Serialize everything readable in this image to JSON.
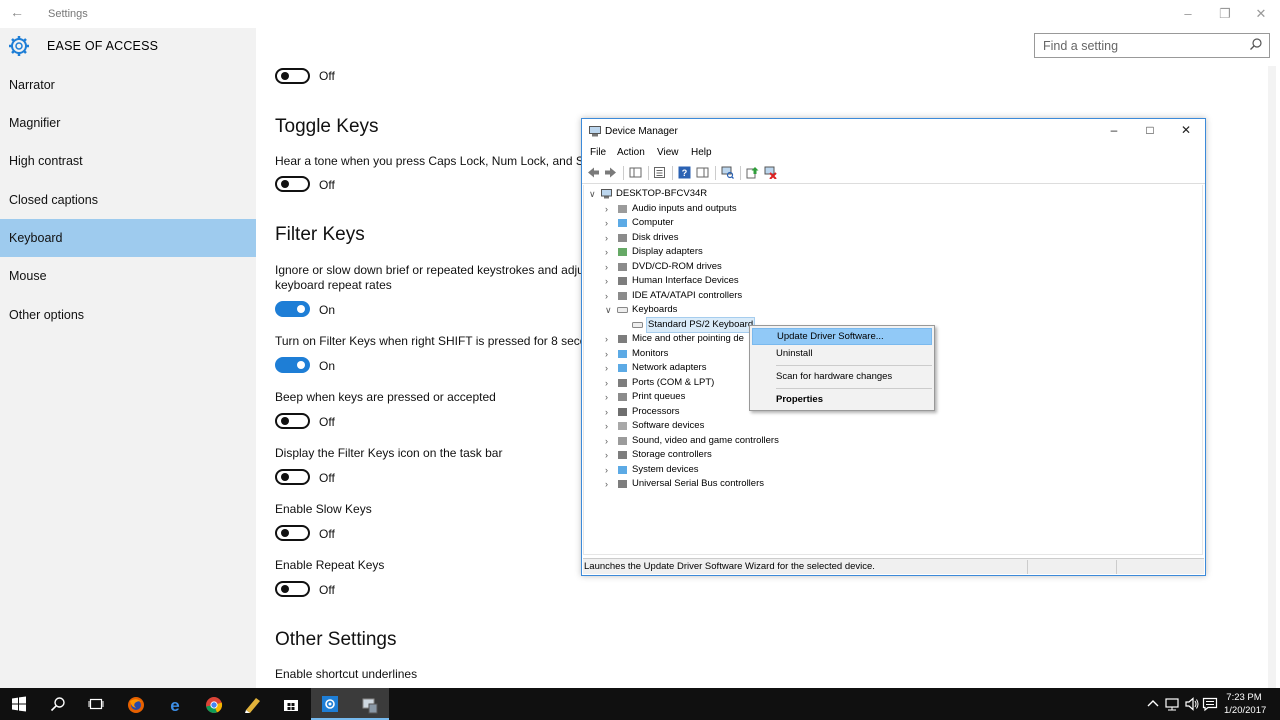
{
  "settings": {
    "app_title": "Settings",
    "header": "EASE OF ACCESS",
    "search_placeholder": "Find a setting",
    "nav": [
      {
        "label": "Narrator"
      },
      {
        "label": "Magnifier"
      },
      {
        "label": "High contrast"
      },
      {
        "label": "Closed captions"
      },
      {
        "label": "Keyboard",
        "active": true
      },
      {
        "label": "Mouse"
      },
      {
        "label": "Other options"
      }
    ],
    "content": {
      "top_toggle_state": "Off",
      "toggle_keys": {
        "heading": "Toggle Keys",
        "desc": "Hear a tone when you press Caps Lock, Num Lock, and Sc",
        "state": "Off"
      },
      "filter_keys": {
        "heading": "Filter Keys",
        "desc1": "Ignore or slow down brief or repeated keystrokes and adju",
        "desc2": "keyboard repeat rates",
        "state": "On",
        "options": [
          {
            "label": "Turn on Filter Keys when right SHIFT is pressed for 8 secon",
            "state": "On"
          },
          {
            "label": "Beep when keys are pressed or accepted",
            "state": "Off"
          },
          {
            "label": "Display the Filter Keys icon on the task bar",
            "state": "Off"
          },
          {
            "label": "Enable Slow Keys",
            "state": "Off"
          },
          {
            "label": "Enable Repeat Keys",
            "state": "Off"
          }
        ]
      },
      "other_settings": {
        "heading": "Other Settings",
        "desc": "Enable shortcut underlines"
      }
    }
  },
  "device_manager": {
    "title": "Device Manager",
    "menu": [
      "File",
      "Action",
      "View",
      "Help"
    ],
    "root": "DESKTOP-BFCV34R",
    "tree": [
      {
        "label": "Audio inputs and outputs",
        "icon": "speaker-icon"
      },
      {
        "label": "Computer",
        "icon": "computer-icon"
      },
      {
        "label": "Disk drives",
        "icon": "disk-icon"
      },
      {
        "label": "Display adapters",
        "icon": "display-adapter-icon"
      },
      {
        "label": "DVD/CD-ROM drives",
        "icon": "dvd-icon"
      },
      {
        "label": "Human Interface Devices",
        "icon": "hid-icon"
      },
      {
        "label": "IDE ATA/ATAPI controllers",
        "icon": "ide-icon"
      },
      {
        "label": "Keyboards",
        "icon": "keyboard-icon",
        "expanded": true
      },
      {
        "label": "Standard PS/2 Keyboard",
        "icon": "keyboard-icon",
        "child": true,
        "selected": true
      },
      {
        "label": "Mice and other pointing de",
        "icon": "mouse-icon"
      },
      {
        "label": "Monitors",
        "icon": "monitor-icon"
      },
      {
        "label": "Network adapters",
        "icon": "network-icon"
      },
      {
        "label": "Ports (COM & LPT)",
        "icon": "port-icon"
      },
      {
        "label": "Print queues",
        "icon": "printer-icon"
      },
      {
        "label": "Processors",
        "icon": "processor-icon"
      },
      {
        "label": "Software devices",
        "icon": "software-device-icon"
      },
      {
        "label": "Sound, video and game controllers",
        "icon": "sound-icon"
      },
      {
        "label": "Storage controllers",
        "icon": "storage-icon"
      },
      {
        "label": "System devices",
        "icon": "system-icon"
      },
      {
        "label": "Universal Serial Bus controllers",
        "icon": "usb-icon"
      }
    ],
    "context_menu": [
      {
        "label": "Update Driver Software...",
        "highlighted": true
      },
      {
        "label": "Uninstall"
      },
      {
        "label": "Scan for hardware changes"
      },
      {
        "label": "Properties",
        "bold": true
      }
    ],
    "status": "Launches the Update Driver Software Wizard for the selected device."
  },
  "taskbar": {
    "time": "7:23 PM",
    "date": "1/20/2017"
  },
  "colors": {
    "selection_blue": "#9ecbee",
    "toggle_on": "#1e7ed6",
    "taskbar": "#101010",
    "menu_highlight": "#91c9f7"
  }
}
